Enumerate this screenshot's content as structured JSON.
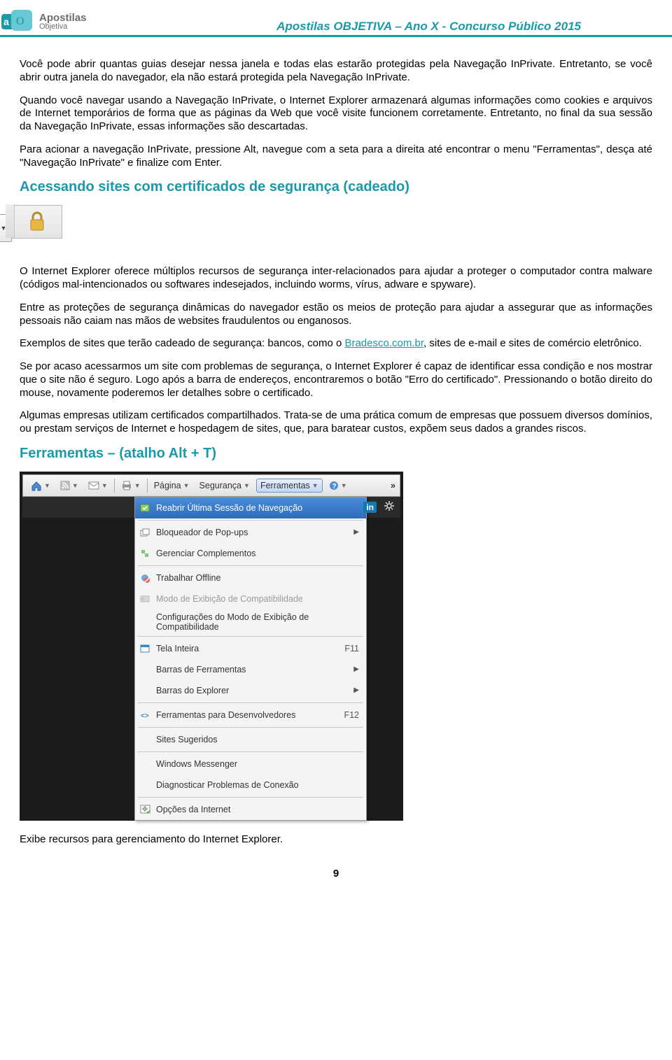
{
  "header": {
    "brand1": "Apostilas",
    "brand2": "Objetiva",
    "title": "Apostilas OBJETIVA – Ano X -  Concurso Público 2015"
  },
  "p1": "Você pode abrir quantas guias desejar nessa janela e todas elas estarão protegidas pela Navegação InPrivate. Entretanto, se você abrir outra janela do navegador, ela não estará protegida pela Navegação InPrivate.",
  "p2": "Quando você navegar usando a Navegação InPrivate, o Internet Explorer armazenará algumas informações como cookies e arquivos de Internet temporários de forma que as páginas da Web que você visite funcionem corretamente. Entretanto, no final da sua sessão da Navegação InPrivate, essas informações são descartadas.",
  "p3": "Para acionar a navegação InPrivate, pressione Alt, navegue com a seta para a direita até encontrar o menu \"Ferramentas\", desça até \"Navegação InPrivate\" e finalize com Enter.",
  "h2a": "Acessando sites com certificados de segurança (cadeado)",
  "p4": "O Internet Explorer oferece múltiplos recursos de segurança inter-relacionados para ajudar a proteger o computador contra malware (códigos mal-intencionados ou softwares indesejados, incluindo worms, vírus, adware e spyware).",
  "p5": "Entre as proteções de segurança dinâmicas do navegador estão os meios de proteção para ajudar a assegurar que as informações pessoais não caiam nas mãos de websites fraudulentos ou enganosos.",
  "p6a": "Exemplos de sites que terão cadeado de segurança: bancos, como o ",
  "p6link": "Bradesco.com.br",
  "p6b": ", sites de e-mail e sites de comércio eletrônico.",
  "p7": "Se por acaso acessarmos um site com problemas de segurança, o Internet Explorer é capaz de identificar essa condição e nos mostrar que o site não é seguro. Logo após a barra de endereços, encontraremos o botão \"Erro do certificado\". Pressionando o botão direito do mouse, novamente poderemos ler detalhes sobre o certificado.",
  "p8": "Algumas empresas utilizam certificados compartilhados. Trata-se de uma prática comum de empresas que possuem diversos domínios, ou prestam serviços de Internet e hospedagem de sites, que, para baratear custos, expõem seus dados a grandes riscos.",
  "h2b": "Ferramentas – (atalho Alt + T)",
  "cmdbar": {
    "page": "Página",
    "sec": "Segurança",
    "tools": "Ferramentas",
    "in": "in"
  },
  "menu": {
    "reopen": "Reabrir Última Sessão de Navegação",
    "popup": "Bloqueador de Pop-ups",
    "addons": "Gerenciar Complementos",
    "offline": "Trabalhar Offline",
    "compat": "Modo de Exibição de Compatibilidade",
    "compatcfg": "Configurações do Modo de Exibição de Compatibilidade",
    "full": "Tela Inteira",
    "full_sc": "F11",
    "toolbars": "Barras de Ferramentas",
    "explorer": "Barras do Explorer",
    "devtools": "Ferramentas para Desenvolvedores",
    "devtools_sc": "F12",
    "suggested": "Sites Sugeridos",
    "msn": "Windows Messenger",
    "diag": "Diagnosticar Problemas de Conexão",
    "opts": "Opções da Internet"
  },
  "p9": "Exibe recursos para gerenciamento do Internet Explorer.",
  "pagenum": "9"
}
